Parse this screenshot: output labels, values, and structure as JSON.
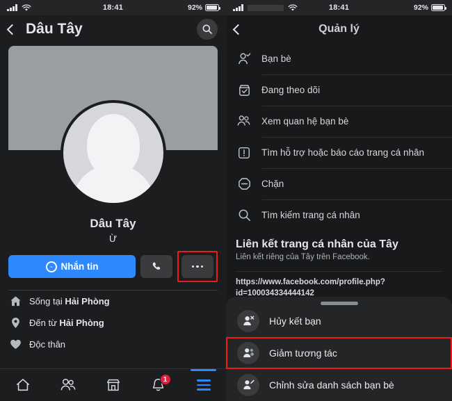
{
  "left": {
    "status": {
      "time": "18:41",
      "battery_pct": "92%",
      "signal": "signal-bars-icon",
      "wifi": "wifi-icon"
    },
    "nav": {
      "back": "back-chevron-icon",
      "title": "Dâu Tây",
      "search": "search-icon"
    },
    "profile": {
      "name": "Dâu Tây",
      "bio": "Ừ"
    },
    "actions": {
      "message_label": "Nhắn tin",
      "message_icon": "messenger-icon",
      "call_icon": "phone-icon",
      "more_icon": "more-dots-icon"
    },
    "info": [
      {
        "icon": "home-icon",
        "prefix": "Sống tại ",
        "value": "Hải Phòng"
      },
      {
        "icon": "location-pin-icon",
        "prefix": "Đến từ ",
        "value": "Hải Phòng"
      },
      {
        "icon": "heart-icon",
        "prefix": "Độc thân",
        "value": ""
      }
    ],
    "tabbar": [
      {
        "name": "home-tab",
        "icon": "home-icon",
        "active": false,
        "badge": ""
      },
      {
        "name": "friends-tab",
        "icon": "friends-icon",
        "active": false,
        "badge": ""
      },
      {
        "name": "marketplace-tab",
        "icon": "store-icon",
        "active": false,
        "badge": ""
      },
      {
        "name": "notifications-tab",
        "icon": "bell-icon",
        "active": false,
        "badge": "1"
      },
      {
        "name": "menu-tab",
        "icon": "hamburger-icon",
        "active": true,
        "badge": ""
      }
    ]
  },
  "right": {
    "status": {
      "time": "18:41",
      "battery_pct": "92%",
      "signal": "signal-bars-icon",
      "wifi": "wifi-icon"
    },
    "nav": {
      "back": "back-chevron-icon",
      "title": "Quản lý"
    },
    "menu": [
      {
        "icon": "person-check-icon",
        "label": "Bạn bè"
      },
      {
        "icon": "following-box-check-icon",
        "label": "Đang theo dõi"
      },
      {
        "icon": "two-people-icon",
        "label": "Xem quan hệ bạn bè"
      },
      {
        "icon": "report-alert-icon",
        "label": "Tìm hỗ trợ hoặc báo cáo trang cá nhân"
      },
      {
        "icon": "block-icon",
        "label": "Chặn"
      },
      {
        "icon": "search-icon",
        "label": "Tìm kiếm trang cá nhân"
      }
    ],
    "link_section": {
      "title": "Liên kết trang cá nhân của Tây",
      "subtitle": "Liên kết riêng của Tây trên Facebook.",
      "url": "https://www.facebook.com/profile.php?id=100034334444142"
    },
    "sheet": {
      "grabber": "drag-handle",
      "items": [
        {
          "icon": "person-remove-icon",
          "label": "Hủy kết bạn",
          "highlighted": false
        },
        {
          "icon": "person-reduce-icon",
          "label": "Giảm tương tác",
          "highlighted": true
        },
        {
          "icon": "person-edit-icon",
          "label": "Chỉnh sửa danh sách bạn bè",
          "highlighted": false
        }
      ]
    }
  },
  "colors": {
    "accent_blue": "#2e89ff",
    "highlight_red": "#ef1b1b",
    "badge_red": "#e41e3f",
    "bg_dark": "#18191a",
    "surface": "#242526"
  }
}
